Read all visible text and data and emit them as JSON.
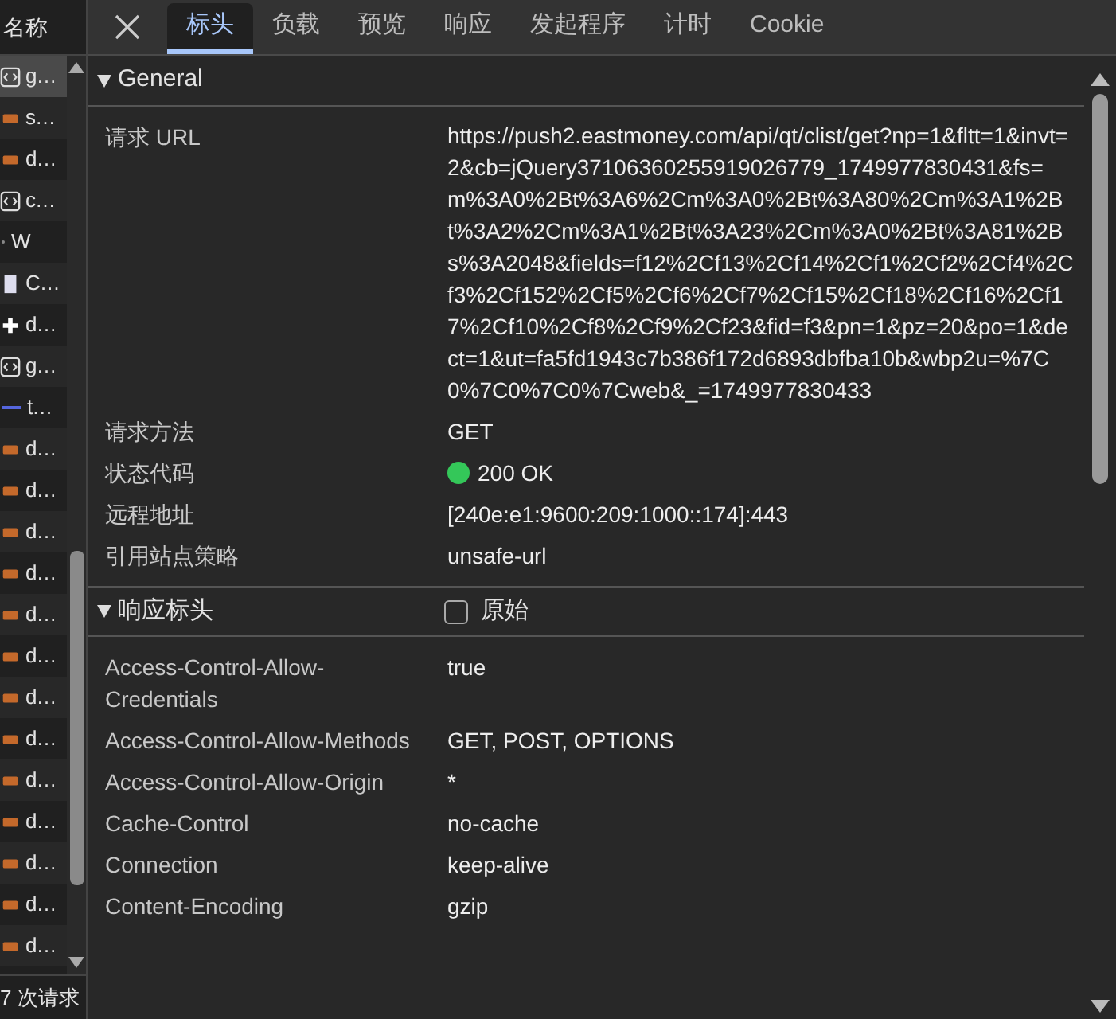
{
  "sidebar": {
    "header": "名称",
    "rows": [
      {
        "name": "g…",
        "kind": "script",
        "selected": true
      },
      {
        "name": "s…",
        "kind": "image",
        "selected": false
      },
      {
        "name": "d…",
        "kind": "image",
        "selected": false
      },
      {
        "name": "c…",
        "kind": "script",
        "selected": false
      },
      {
        "name": "W",
        "kind": "blank",
        "selected": false
      },
      {
        "name": "C…",
        "kind": "doc",
        "selected": false
      },
      {
        "name": "d…",
        "kind": "plus",
        "selected": false
      },
      {
        "name": "g…",
        "kind": "script",
        "selected": false
      },
      {
        "name": "t…",
        "kind": "line",
        "selected": false
      },
      {
        "name": "d…",
        "kind": "image",
        "selected": false
      },
      {
        "name": "d…",
        "kind": "image",
        "selected": false
      },
      {
        "name": "d…",
        "kind": "image",
        "selected": false
      },
      {
        "name": "d…",
        "kind": "image",
        "selected": false
      },
      {
        "name": "d…",
        "kind": "image",
        "selected": false
      },
      {
        "name": "d…",
        "kind": "image",
        "selected": false
      },
      {
        "name": "d…",
        "kind": "image",
        "selected": false
      },
      {
        "name": "d…",
        "kind": "image",
        "selected": false
      },
      {
        "name": "d…",
        "kind": "image",
        "selected": false
      },
      {
        "name": "d…",
        "kind": "image",
        "selected": false
      },
      {
        "name": "d…",
        "kind": "image",
        "selected": false
      },
      {
        "name": "d…",
        "kind": "image",
        "selected": false
      },
      {
        "name": "d…",
        "kind": "image",
        "selected": false
      }
    ],
    "status": "7 次请求"
  },
  "tabs": [
    {
      "label": "标头",
      "selected": true
    },
    {
      "label": "负载",
      "selected": false
    },
    {
      "label": "预览",
      "selected": false
    },
    {
      "label": "响应",
      "selected": false
    },
    {
      "label": "发起程序",
      "selected": false
    },
    {
      "label": "计时",
      "selected": false
    },
    {
      "label": "Cookie",
      "selected": false
    }
  ],
  "sections": [
    {
      "title": "General",
      "expanded": true,
      "rows": [
        {
          "name": "请求 URL",
          "value": "https://push2.eastmoney.com/api/qt/clist/get?np=1&fltt=1&invt=2&cb=jQuery37106360255919026779_1749977830431&fs=m%3A0%2Bt%3A6%2Cm%3A0%2Bt%3A80%2Cm%3A1%2Bt%3A2%2Cm%3A1%2Bt%3A23%2Cm%3A0%2Bt%3A81%2Bs%3A2048&fields=f12%2Cf13%2Cf14%2Cf1%2Cf2%2Cf4%2Cf3%2Cf152%2Cf5%2Cf6%2Cf7%2Cf15%2Cf18%2Cf16%2Cf17%2Cf10%2Cf8%2Cf9%2Cf23&fid=f3&pn=1&pz=20&po=1&dect=1&ut=fa5fd1943c7b386f172d6893dbfba10b&wbp2u=%7C0%7C0%7C0%7Cweb&_=1749977830433"
        },
        {
          "name": "请求方法",
          "value": "GET"
        },
        {
          "name": "状态代码",
          "value": "200 OK",
          "color": "#34c759"
        },
        {
          "name": "远程地址",
          "value": "[240e:e1:9600:209:1000::174]:443"
        },
        {
          "name": "引用站点策略",
          "value": "unsafe-url"
        }
      ]
    },
    {
      "title": "响应标头",
      "expanded": true,
      "raw": {
        "label": "原始",
        "checked": false
      },
      "rows": [
        {
          "name": "Access-Control-Allow-Credentials",
          "value": "true"
        },
        {
          "name": "Access-Control-Allow-Methods",
          "value": "GET, POST, OPTIONS"
        },
        {
          "name": "Access-Control-Allow-Origin",
          "value": "*"
        },
        {
          "name": "Cache-Control",
          "value": "no-cache"
        },
        {
          "name": "Connection",
          "value": "keep-alive"
        },
        {
          "name": "Content-Encoding",
          "value": "gzip"
        }
      ]
    }
  ]
}
